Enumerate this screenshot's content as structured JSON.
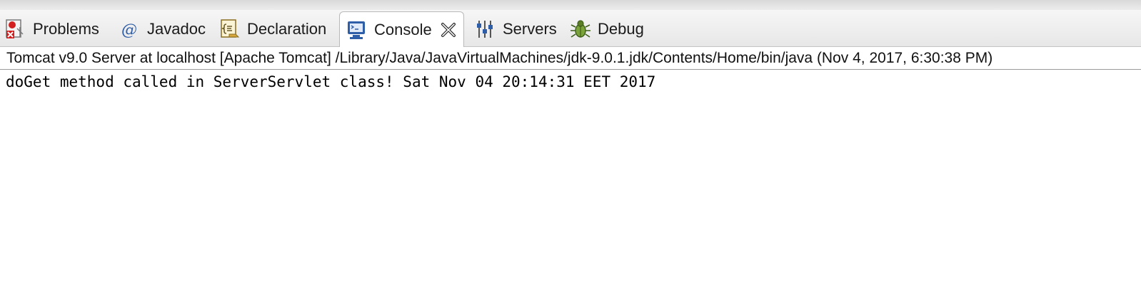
{
  "tabs": [
    {
      "label": "Problems",
      "icon": "problems-icon"
    },
    {
      "label": "Javadoc",
      "icon": "javadoc-icon"
    },
    {
      "label": "Declaration",
      "icon": "declaration-icon"
    },
    {
      "label": "Console",
      "icon": "console-icon",
      "active": true
    },
    {
      "label": "Servers",
      "icon": "servers-icon"
    },
    {
      "label": "Debug",
      "icon": "debug-icon"
    }
  ],
  "console": {
    "process_label": "Tomcat v9.0 Server at localhost [Apache Tomcat] /Library/Java/JavaVirtualMachines/jdk-9.0.1.jdk/Contents/Home/bin/java (Nov 4, 2017, 6:30:38 PM)",
    "lines": [
      "doGet method called in ServerServlet class! Sat Nov 04 20:14:31 EET 2017"
    ]
  },
  "colors": {
    "accent": "#2f5ea8",
    "tab_border": "#b9b9b9"
  }
}
